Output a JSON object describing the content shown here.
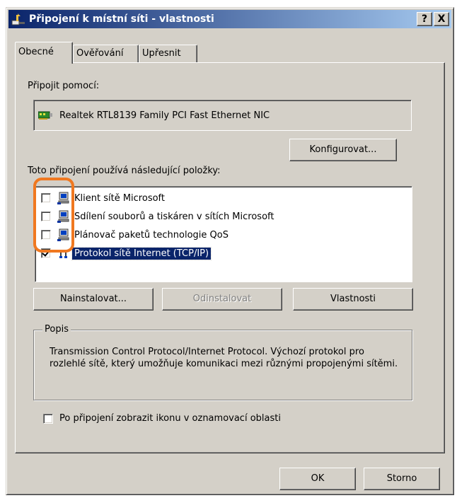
{
  "window": {
    "title": "Připojení k místní síti - vlastnosti",
    "help_label": "?",
    "close_label": "X"
  },
  "tabs": [
    {
      "label": "Obecné",
      "active": true
    },
    {
      "label": "Ověřování",
      "active": false
    },
    {
      "label": "Upřesnit",
      "active": false
    }
  ],
  "general": {
    "connect_using_label": "Připojit pomocí:",
    "adapter_name": "Realtek RTL8139 Family PCI Fast Ethernet NIC",
    "configure_label": "Konfigurovat...",
    "items_label": "Toto připojení používá následující položky:",
    "items": [
      {
        "label": "Klient sítě Microsoft",
        "checked": false,
        "icon": "network-client-icon"
      },
      {
        "label": "Sdílení souborů a tiskáren v sítích Microsoft",
        "checked": false,
        "icon": "file-sharing-icon"
      },
      {
        "label": "Plánovač paketů technologie QoS",
        "checked": false,
        "icon": "qos-scheduler-icon"
      },
      {
        "label": "Protokol sítě Internet (TCP/IP)",
        "checked": true,
        "selected": true,
        "icon": "protocol-icon"
      }
    ],
    "install_label": "Nainstalovat...",
    "uninstall_label": "Odinstalovat",
    "properties_label": "Vlastnosti",
    "description_title": "Popis",
    "description_text": "Transmission Control Protocol/Internet Protocol. Výchozí protokol pro rozlehlé sítě, který umožňuje komunikaci mezi různými propojenými sítěmi.",
    "show_icon_label": "Po připojení zobrazit ikonu v oznamovací oblasti",
    "show_icon_checked": false
  },
  "footer": {
    "ok_label": "OK",
    "cancel_label": "Storno"
  },
  "colors": {
    "titlebar_start": "#0a246a",
    "titlebar_end": "#a6caf0",
    "face": "#d4d0c8",
    "selection": "#0a246a",
    "highlight_outline": "#f07820"
  }
}
